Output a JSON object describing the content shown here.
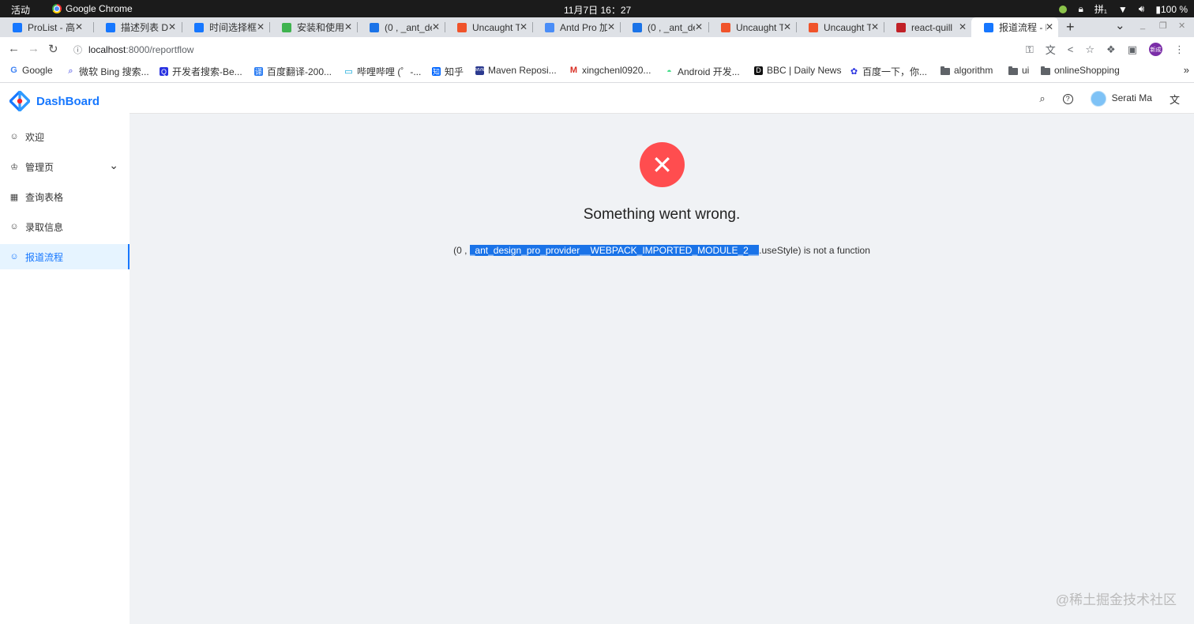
{
  "os": {
    "activities": "活动",
    "app_name": "Google Chrome",
    "clock": "11月7日  16：27",
    "input_method": "拼₁",
    "battery": "100 %"
  },
  "tabs": [
    {
      "title": "ProList - 高",
      "icon_color": "#1677ff"
    },
    {
      "title": "描述列表 D",
      "icon_color": "#1677ff"
    },
    {
      "title": "时间选择框",
      "icon_color": "#1677ff"
    },
    {
      "title": "安装和使用",
      "icon_color": "#3fb34f"
    },
    {
      "title": "(0 , _ant_de",
      "icon_color": "#1a73e8"
    },
    {
      "title": "Uncaught T",
      "icon_color": "#f0532a"
    },
    {
      "title": "Antd Pro 加",
      "icon_color": "#4a8df7"
    },
    {
      "title": "(0 , _ant_de",
      "icon_color": "#1a73e8"
    },
    {
      "title": "Uncaught T",
      "icon_color": "#f0532a"
    },
    {
      "title": "Uncaught T",
      "icon_color": "#f0532a"
    },
    {
      "title": "react-quill",
      "icon_color": "#c12127"
    },
    {
      "title": "报道流程 - D",
      "icon_color": "#1677ff"
    }
  ],
  "address_bar": {
    "host": "localhost",
    "path": ":8000/reportflow"
  },
  "profile_badge": "新成",
  "bookmarks": [
    {
      "label": "Google",
      "icon": "G"
    },
    {
      "label": "微软 Bing 搜索...",
      "icon": "search-icon"
    },
    {
      "label": "开发者搜索-Be...",
      "icon": "Q"
    },
    {
      "label": "百度翻译-200...",
      "icon": "译"
    },
    {
      "label": "哔哩哔哩 (゜-...",
      "icon": "tv-icon"
    },
    {
      "label": "知乎",
      "icon": "知"
    },
    {
      "label": "Maven Reposi...",
      "icon": "MVN"
    },
    {
      "label": "xingchenl0920...",
      "icon": "M"
    },
    {
      "label": "Android 开发...",
      "icon": "android-icon"
    },
    {
      "label": "BBC | Daily News",
      "icon": "D"
    },
    {
      "label": "百度一下，你...",
      "icon": "paw-icon"
    },
    {
      "label": "algorithm",
      "icon": "folder-icon"
    },
    {
      "label": "ui",
      "icon": "folder-icon"
    },
    {
      "label": "onlineShopping",
      "icon": "folder-icon"
    }
  ],
  "brand": {
    "name": "DashBoard",
    "color": "#1677ff"
  },
  "menu": [
    {
      "label": "欢迎",
      "icon": "smile-icon",
      "selected": false
    },
    {
      "label": "管理页",
      "icon": "crown-icon",
      "selected": false,
      "has_submenu": true
    },
    {
      "label": "查询表格",
      "icon": "table-icon",
      "selected": false
    },
    {
      "label": "录取信息",
      "icon": "smile-icon",
      "selected": false
    },
    {
      "label": "报道流程",
      "icon": "smile-icon",
      "selected": true
    }
  ],
  "header": {
    "user_name": "Serati Ma"
  },
  "error": {
    "title": "Something went wrong.",
    "message_prefix": "(0 , ",
    "message_selected": "_ant_design_pro_provider__WEBPACK_IMPORTED_MODULE_2__",
    "message_suffix": ".useStyle) is not a function"
  },
  "watermark": "@稀土掘金技术社区"
}
